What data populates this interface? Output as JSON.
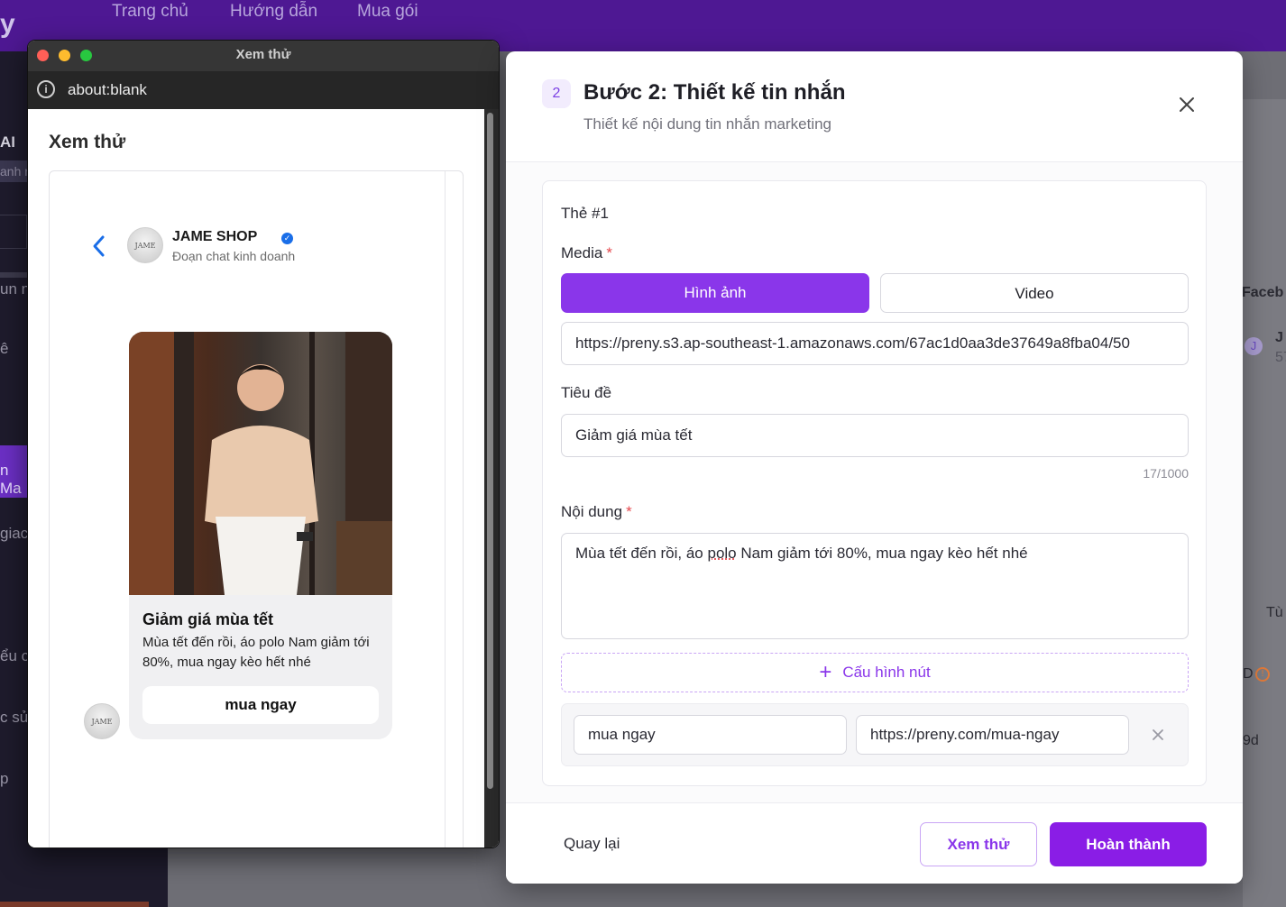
{
  "background_app": {
    "logo_fragment": "y",
    "nav": [
      "Trang chủ",
      "Hướng dẫn",
      "Mua gói"
    ],
    "sidebar_fragments": [
      "AI",
      "anh r",
      "",
      "un n",
      "ê",
      "n Ma",
      "giac",
      "ểu c",
      "c sử",
      "p"
    ],
    "right_fragments": [
      "Faceb",
      "J",
      "57",
      "Tù",
      "D",
      "9d"
    ]
  },
  "browser": {
    "window_title": "Xem thử",
    "url": "about:blank",
    "preview_title": "Xem thử",
    "messenger": {
      "shop_name": "JAME SHOP",
      "shop_subtitle": "Đoạn chat kinh doanh",
      "avatar_text": "JAME",
      "card": {
        "title": "Giảm giá mùa tết",
        "body": "Mùa tết đến rồi, áo polo Nam giảm tới 80%, mua ngay kèo hết nhé",
        "button": "mua ngay"
      }
    }
  },
  "modal": {
    "step_number": "2",
    "title": "Bước 2: Thiết kế tin nhắn",
    "subtitle": "Thiết kế nội dung tin nhắn marketing",
    "card_label": "Thẻ #1",
    "media_label": "Media",
    "required_mark": "*",
    "media_options": [
      "Hình ảnh",
      "Video"
    ],
    "media_url": "https://preny.s3.ap-southeast-1.amazonaws.com/67ac1d0aa3de37649a8fba04/50",
    "title_label": "Tiêu đề",
    "title_value": "Giảm giá mùa tết",
    "title_counter": "17/1000",
    "content_label": "Nội dung",
    "content_value_before": "Mùa tết đến rồi, áo ",
    "content_value_flagged": "polo",
    "content_value_after": " Nam giảm tới 80%, mua ngay kèo hết nhé",
    "config_button": "Cấu hình nút",
    "button_text": "mua ngay",
    "button_url": "https://preny.com/mua-ngay",
    "footer": {
      "back": "Quay lại",
      "preview": "Xem thử",
      "done": "Hoàn thành"
    }
  },
  "colors": {
    "accent": "#8a36ea",
    "nav_bg": "#4e1893",
    "required": "#e5484d"
  }
}
